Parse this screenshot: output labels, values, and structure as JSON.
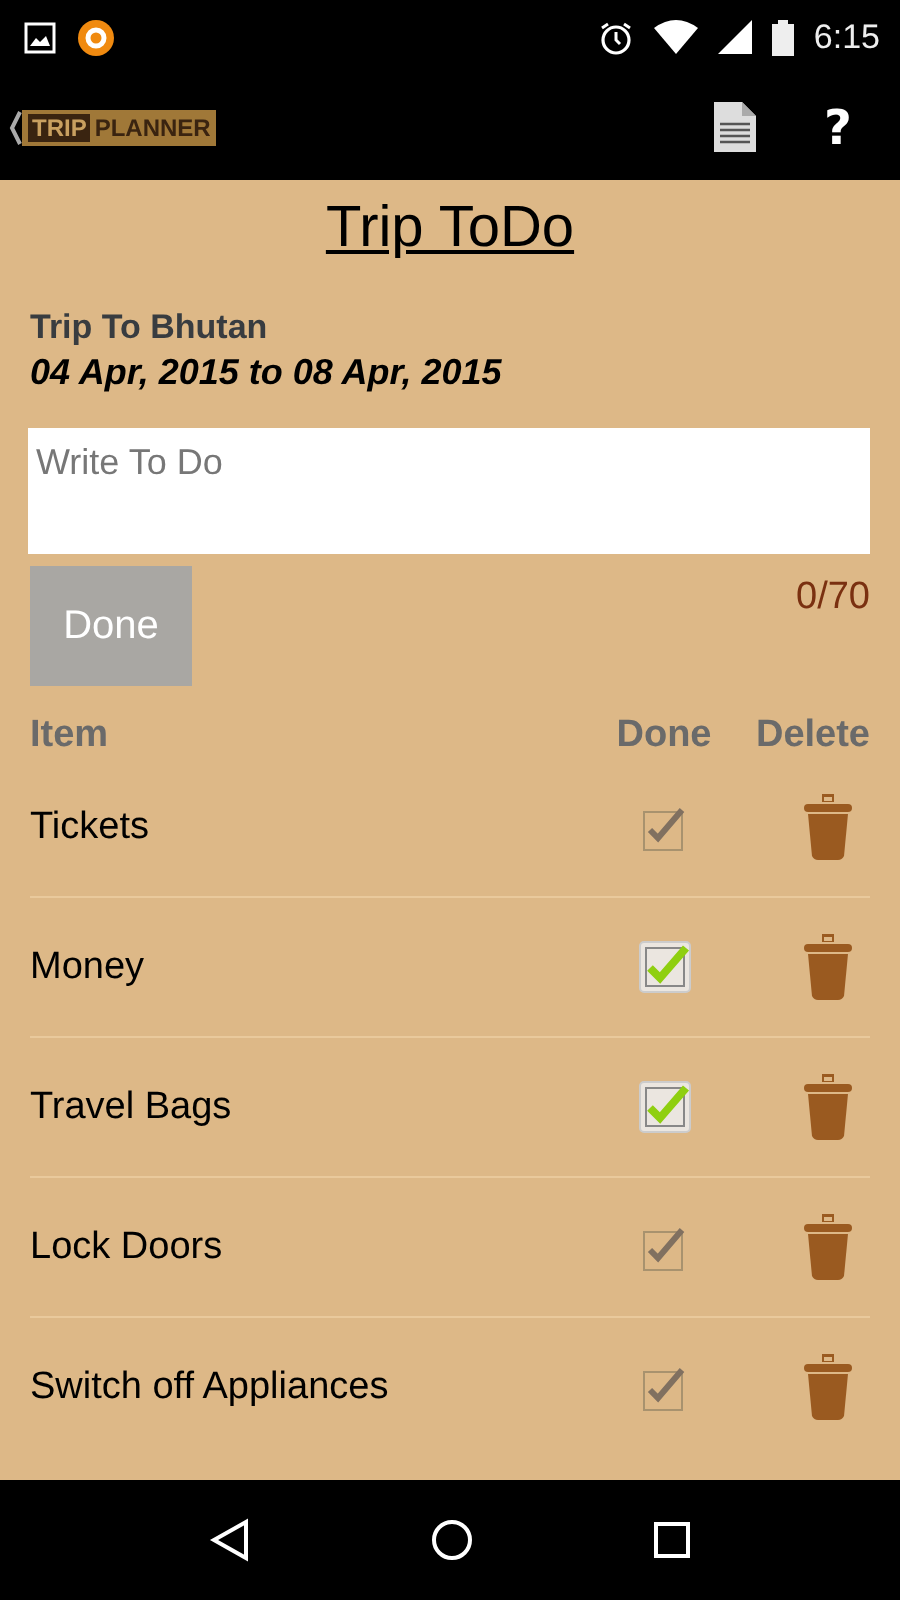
{
  "status_bar": {
    "time": "6:15"
  },
  "app_bar": {
    "logo_left": "TRIP",
    "logo_right": "PLANNER",
    "help": "?"
  },
  "title": "Trip ToDo",
  "trip": {
    "name": "Trip To Bhutan",
    "dates": "04 Apr, 2015 to 08 Apr, 2015"
  },
  "todo_field": {
    "placeholder": "Write To Do"
  },
  "done_button": {
    "label": "Done",
    "disabled": true
  },
  "counter": "0/70",
  "columns": [
    "Item",
    "Done",
    "Delete"
  ],
  "items": [
    {
      "name": "Tickets",
      "checked": false
    },
    {
      "name": "Money",
      "checked": true
    },
    {
      "name": "Travel Bags",
      "checked": true
    },
    {
      "name": "Lock Doors",
      "checked": false
    },
    {
      "name": "Switch off Appliances",
      "checked": false
    }
  ]
}
